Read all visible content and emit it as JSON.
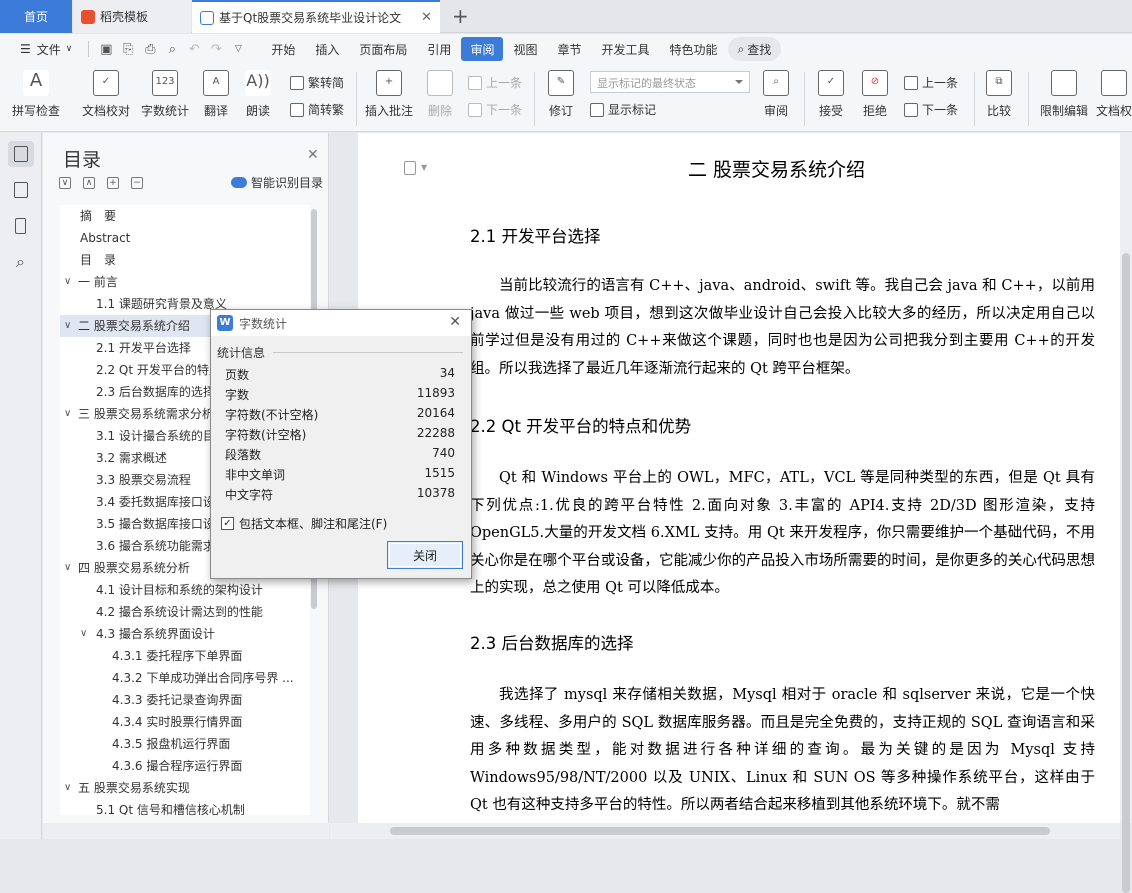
{
  "tabs": {
    "home": "首页",
    "daoke": "稻壳模板",
    "doc": "基于Qt股票交易系统毕业设计论文"
  },
  "menu": {
    "file": "文件",
    "items": [
      "开始",
      "插入",
      "页面布局",
      "引用",
      "审阅",
      "视图",
      "章节",
      "开发工具",
      "特色功能"
    ],
    "active": "审阅",
    "search": "查找"
  },
  "ribbon": {
    "spell": "拼写检查",
    "proof": "文档校对",
    "wordcount": "字数统计",
    "translate": "翻译",
    "read": "朗读",
    "trad": "繁转简",
    "simp": "简转繁",
    "insert_comment": "插入批注",
    "delete": "删除",
    "prev_comment": "上一条",
    "next_comment": "下一条",
    "revise": "修订",
    "markup_state": "显示标记的最终状态",
    "show_markup": "显示标记",
    "review": "审阅",
    "accept": "接受",
    "reject": "拒绝",
    "prev": "上一条",
    "next": "下一条",
    "compare": "比较",
    "restrict": "限制编辑",
    "doc_perm": "文档权"
  },
  "nav": {
    "title": "目录",
    "smart": "智能识别目录",
    "items": [
      {
        "text": "摘　要",
        "level": 0
      },
      {
        "text": "Abstract",
        "level": 0
      },
      {
        "text": "目　录",
        "level": 0
      },
      {
        "text": "一  前言",
        "level": -1,
        "caret": "∨"
      },
      {
        "text": "1.1  课题研究背景及意义",
        "level": 1
      },
      {
        "text": "二  股票交易系统介绍",
        "level": -1,
        "caret": "∨",
        "active": true
      },
      {
        "text": "2.1  开发平台选择",
        "level": 1
      },
      {
        "text": "2.2 Qt 开发平台的特点和优势",
        "level": 1
      },
      {
        "text": "2.3  后台数据库的选择",
        "level": 1
      },
      {
        "text": "三  股票交易系统需求分析",
        "level": -1,
        "caret": "∨"
      },
      {
        "text": "3.1  设计撮合系统的目的",
        "level": 1
      },
      {
        "text": "3.2  需求概述",
        "level": 1
      },
      {
        "text": "3.3  股票交易流程",
        "level": 1
      },
      {
        "text": "3.4  委托数据库接口设计",
        "level": 1
      },
      {
        "text": "3.5  撮合数据库接口设计",
        "level": 1
      },
      {
        "text": "3.6  撮合系统功能需求",
        "level": 1
      },
      {
        "text": "四  股票交易系统分析",
        "level": -1,
        "caret": "∨"
      },
      {
        "text": "4.1  设计目标和系统的架构设计",
        "level": 1
      },
      {
        "text": "4.2  撮合系统设计需达到的性能",
        "level": 1
      },
      {
        "text": "4.3  撮合系统界面设计",
        "level": 2,
        "caret": "∨"
      },
      {
        "text": "4.3.1  委托程序下单界面",
        "level": 3
      },
      {
        "text": "4.3.2  下单成功弹出合同序号界 ...",
        "level": 3
      },
      {
        "text": "4.3.3  委托记录查询界面",
        "level": 3
      },
      {
        "text": "4.3.4  实时股票行情界面",
        "level": 3
      },
      {
        "text": "4.3.5  报盘机运行界面",
        "level": 3
      },
      {
        "text": "4.3.6  撮合程序运行界面",
        "level": 3
      },
      {
        "text": "五  股票交易系统实现",
        "level": -1,
        "caret": "∨"
      },
      {
        "text": "5.1 Qt 信号和槽信核心机制",
        "level": 1
      }
    ]
  },
  "doc": {
    "h2": "二  股票交易系统介绍",
    "s21": "2.1  开发平台选择",
    "p1": "当前比较流行的语言有 C++、java、android、swift 等。我自己会 java 和 C++，以前用 java 做过一些 web 项目，想到这次做毕业设计自己会投入比较大多的经历，所以决定用自己以前学过但是没有用过的 C++来做这个课题，同时也也是因为公司把我分到主要用 C++的开发组。所以我选择了最近几年逐渐流行起来的 Qt 跨平台框架。",
    "s22": "2.2 Qt 开发平台的特点和优势",
    "p2": "Qt 和 Windows 平台上的 OWL，MFC，ATL，VCL 等是同种类型的东西，但是 Qt 具有下列优点:1.优良的跨平台特性 2.面向对象 3.丰富的 API4.支持 2D/3D 图形渲染，支持 OpenGL5.大量的开发文档 6.XML 支持。用 Qt 来开发程序，你只需要维护一个基础代码，不用关心你是在哪个平台或设备，它能减少你的产品投入市场所需要的时间，是你更多的关心代码思想上的实现，总之使用 Qt 可以降低成本。",
    "s23": "2.3  后台数据库的选择",
    "p3": "我选择了 mysql 来存储相关数据，Mysql 相对于 oracle 和 sqlserver 来说，它是一个快速、多线程、多用户的 SQL 数据库服务器。而且是完全免费的，支持正规的 SQL 查询语言和采用多种数据类型，能对数据进行各种详细的查询。最为关键的是因为 Mysql 支持 Windows95/98/NT/2000 以及 UNIX、Linux 和 SUN OS 等多种操作系统平台，这样由于 Qt 也有这种支持多平台的特性。所以两者结合起来移植到其他系统环境下。就不需"
  },
  "dialog": {
    "title": "字数统计",
    "group": "统计信息",
    "rows": [
      {
        "label": "页数",
        "value": "34"
      },
      {
        "label": "字数",
        "value": "11893"
      },
      {
        "label": "字符数(不计空格)",
        "value": "20164"
      },
      {
        "label": "字符数(计空格)",
        "value": "22288"
      },
      {
        "label": "段落数",
        "value": "740"
      },
      {
        "label": "非中文单词",
        "value": "1515"
      },
      {
        "label": "中文字符",
        "value": "10378"
      }
    ],
    "checkbox": "包括文本框、脚注和尾注(F)",
    "checked": true,
    "close_btn": "关闭"
  }
}
